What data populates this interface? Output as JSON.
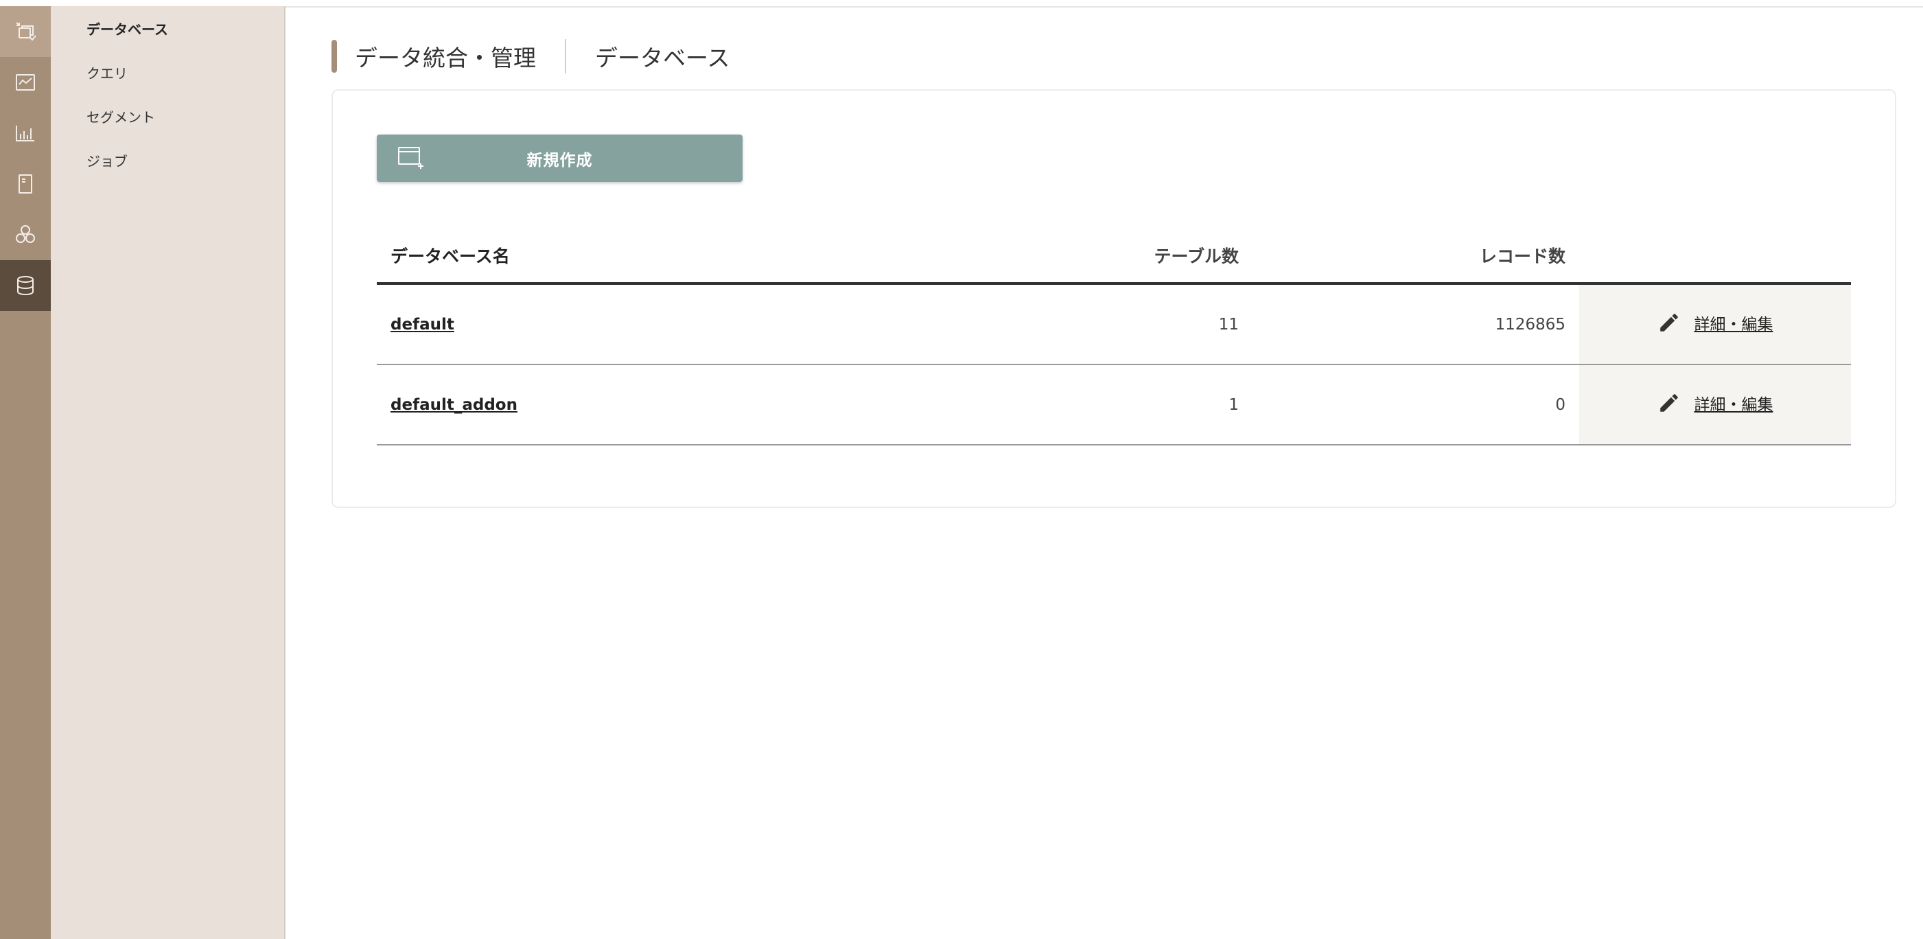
{
  "header": {
    "title": "データ統合・管理",
    "subtitle": "データベース"
  },
  "rail": {
    "icons": [
      "import-icon",
      "line-chart-icon",
      "bar-chart-icon",
      "document-icon",
      "segment-icon",
      "database-icon"
    ],
    "colors": {
      "rail": "#a58e78",
      "active": "#5b4c3d",
      "top": "#b9a28d"
    }
  },
  "subnav": {
    "items": [
      {
        "label": "データベース",
        "active": true
      },
      {
        "label": "クエリ",
        "active": false
      },
      {
        "label": "セグメント",
        "active": false
      },
      {
        "label": "ジョブ",
        "active": false
      }
    ]
  },
  "new_button": {
    "label": "新規作成",
    "color": "#85a29e"
  },
  "table": {
    "headers": {
      "name": "データベース名",
      "tables": "テーブル数",
      "records": "レコード数",
      "actions": ""
    },
    "rows": [
      {
        "name": "default",
        "tables": "11",
        "records": "1126865",
        "action": "詳細・編集"
      },
      {
        "name": "default_addon",
        "tables": "1",
        "records": "0",
        "action": "詳細・編集"
      }
    ]
  }
}
